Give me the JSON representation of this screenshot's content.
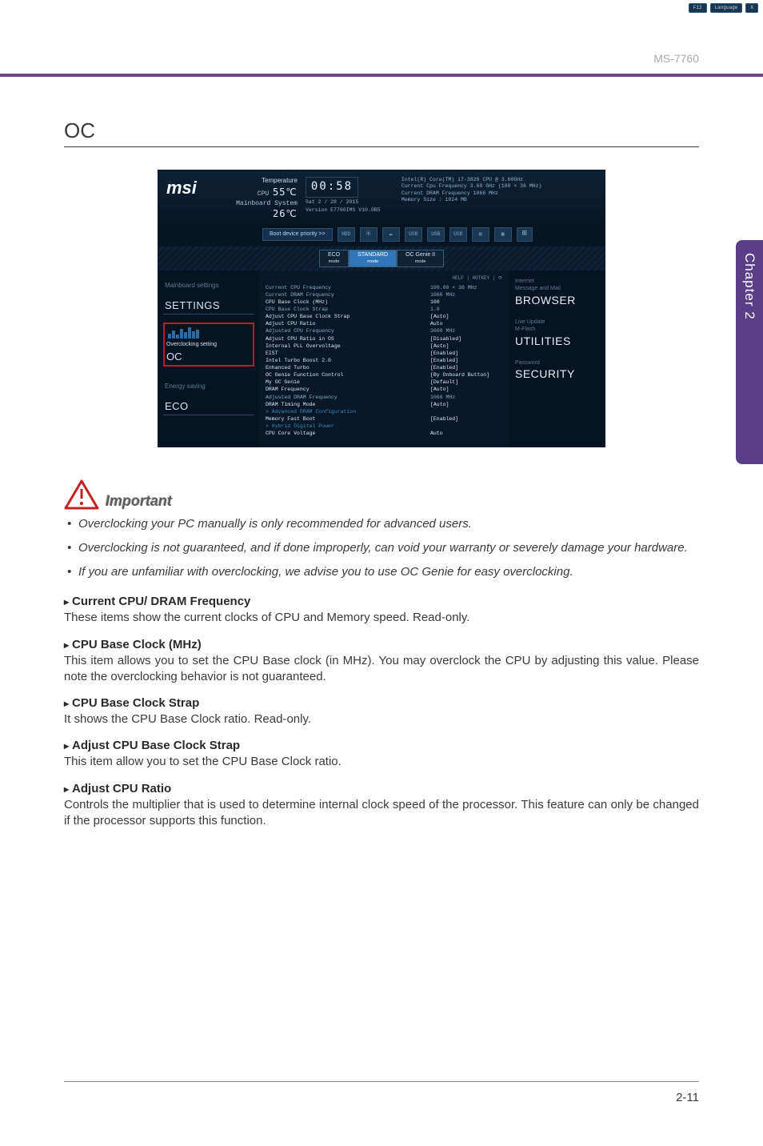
{
  "header": {
    "model": "MS-7760"
  },
  "side_tab": "Chapter 2",
  "heading": "OC",
  "page_number": "2-11",
  "bios": {
    "lang_buttons": [
      "F12",
      "Language",
      "X"
    ],
    "logo": "msi",
    "temp": {
      "label": "Temperature",
      "cpu_label": "CPU",
      "cpu_value": "55℃",
      "mb_label": "Mainboard\nSystem",
      "mb_value": "26℃"
    },
    "clock": {
      "time": "00:58",
      "date": "Sat  2 / 28 / 2015",
      "version": "Version E7760IMS V10.0B5"
    },
    "sysinfo": [
      "Intel(R) Core(TM) i7-3820 CPU @ 3.60GHz",
      "Current Cpu Frequency 3.60 GHz (100 × 36 MHz)",
      "Current DRAM Frequency 1066 MHz",
      "Memory Size : 1024 MB"
    ],
    "boot_label": "Boot device priority  >>",
    "boot_devs": [
      "HDD",
      "⦿",
      "▬",
      "USB",
      "USB",
      "USB",
      "▤",
      "▦"
    ],
    "boot_extra": "⊞",
    "modes": [
      {
        "label": "ECO",
        "sub": "mode",
        "active": false
      },
      {
        "label": "STANDARD",
        "sub": "mode",
        "active": true
      },
      {
        "label": "OC Genie II",
        "sub": "mode",
        "active": false
      }
    ],
    "left_nav": {
      "top_small": "Mainboard settings",
      "top_big": "SETTINGS",
      "callout_small": "Overclocking setting",
      "callout_big": "OC",
      "bot_small": "Energy saving",
      "bot_big": "ECO"
    },
    "center": {
      "help": "HELP | HOTKEY | ⟳",
      "rows": [
        {
          "k": "Current CPU Frequency",
          "v": "100.00 × 36 MHz"
        },
        {
          "k": "Current DRAM Frequency",
          "v": "1066 MHz"
        },
        {
          "k": "CPU Base Clock (MHz)",
          "v": "100",
          "hl": true
        },
        {
          "k": "CPU Base Clock Strap",
          "v": "1.0"
        },
        {
          "k": "Adjust CPU Base Clock Strap",
          "v": "[Auto]",
          "hl": true
        },
        {
          "k": "Adjust CPU Ratio",
          "v": "Auto",
          "hl": true
        },
        {
          "k": "Adjusted CPU Frequency",
          "v": "3600 MHz"
        },
        {
          "k": "Adjust CPU Ratio in OS",
          "v": "[Disabled]",
          "hl": true
        },
        {
          "k": "Internal PLL Overvoltage",
          "v": "[Auto]",
          "hl": true
        },
        {
          "k": "EIST",
          "v": "[Enabled]",
          "hl": true
        },
        {
          "k": "Intel Turbo Boost 2.0",
          "v": "[Enabled]",
          "hl": true
        },
        {
          "k": "Enhanced Turbo",
          "v": "[Enabled]",
          "hl": true
        },
        {
          "k": "OC Genie Function Control",
          "v": "[By Onboard Button]",
          "hl": true
        },
        {
          "k": "My OC Genie",
          "v": "[Default]",
          "hl": true
        },
        {
          "k": "DRAM Frequency",
          "v": "[Auto]",
          "hl": true
        },
        {
          "k": "Adjusted DRAM Frequency",
          "v": "1066 MHz"
        },
        {
          "k": "DRAM Timing Mode",
          "v": "[Auto]",
          "hl": true
        },
        {
          "k": "Advanced DRAM Configuration",
          "v": "",
          "link": true
        },
        {
          "k": "Memory Fast Boot",
          "v": "[Enabled]",
          "hl": true
        },
        {
          "k": "Hybrid Digital Power",
          "v": "",
          "link": true
        },
        {
          "k": "CPU Core Voltage",
          "v": "Auto",
          "hl": true
        }
      ]
    },
    "right": [
      {
        "title": "Internet",
        "sub": "Message and Mail",
        "big": "BROWSER"
      },
      {
        "title": "Live Update",
        "sub": "M-Flash",
        "big": "UTILITIES"
      },
      {
        "title": "Password",
        "sub": "",
        "big": "SECURITY"
      }
    ]
  },
  "important": {
    "label": "Important",
    "items": [
      "Overclocking your PC manually is only recommended for advanced users.",
      "Overclocking is not guaranteed, and if done improperly, can void your warranty or severely damage your hardware.",
      "If you are unfamiliar with overclocking, we advise you to use OC Genie for easy overclocking."
    ]
  },
  "sections": [
    {
      "title": "Current CPU/ DRAM Frequency",
      "body": "These items show the current clocks of CPU and Memory speed. Read-only."
    },
    {
      "title": "CPU Base Clock (MHz)",
      "body": "This item allows you to set the CPU Base clock (in MHz). You may overclock the CPU by adjusting this value. Please note the overclocking behavior is not guaranteed."
    },
    {
      "title": "CPU Base Clock Strap",
      "body": "It shows the CPU Base Clock ratio. Read-only."
    },
    {
      "title": "Adjust CPU Base Clock Strap",
      "body": "This item allow you to set the CPU Base Clock ratio."
    },
    {
      "title": "Adjust CPU Ratio",
      "body": "Controls the multiplier that is used to determine internal clock speed of the processor. This feature can only be changed if the processor supports this function."
    }
  ],
  "chart_data": {
    "type": "bar",
    "note": "Miniature decorative bar chart inside BIOS left sidebar (Overclocking setting thumbnail). Heights approximate, no axis labels present.",
    "categories": [
      "b1",
      "b2",
      "b3",
      "b4",
      "b5",
      "b6",
      "b7",
      "b8"
    ],
    "values": [
      6,
      10,
      5,
      12,
      8,
      14,
      9,
      11
    ]
  }
}
